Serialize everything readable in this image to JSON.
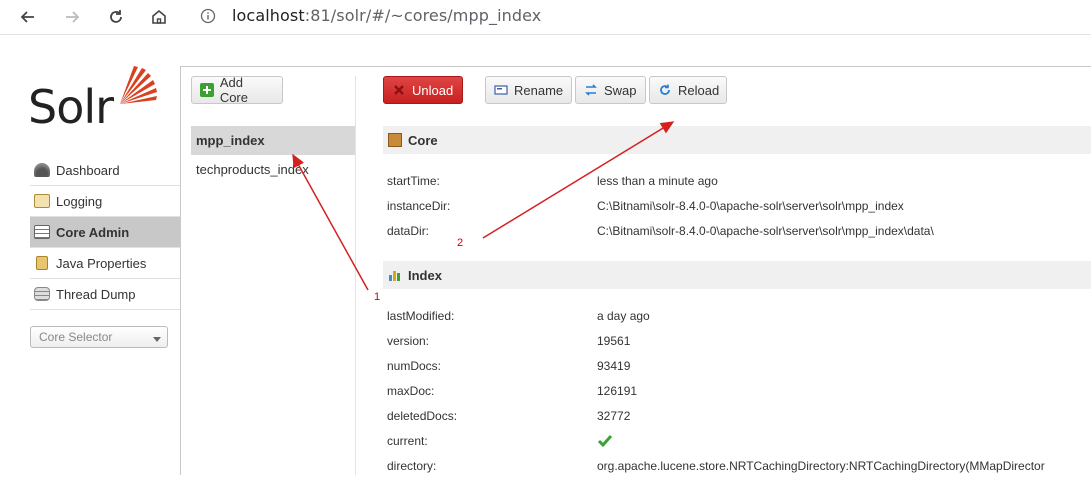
{
  "browser": {
    "url_host": "localhost",
    "url_path": ":81/solr/#/~cores/mpp_index"
  },
  "logo": {
    "text": "Solr"
  },
  "sidebar": {
    "items": [
      {
        "label": "Dashboard",
        "active": false,
        "icon": "dashboard-icon"
      },
      {
        "label": "Logging",
        "active": false,
        "icon": "logging-icon"
      },
      {
        "label": "Core Admin",
        "active": true,
        "icon": "core-admin-icon"
      },
      {
        "label": "Java Properties",
        "active": false,
        "icon": "java-properties-icon"
      },
      {
        "label": "Thread Dump",
        "active": false,
        "icon": "thread-dump-icon"
      }
    ],
    "core_selector": "Core Selector"
  },
  "toolbar": {
    "add_core": "Add Core",
    "unload": "Unload",
    "rename": "Rename",
    "swap": "Swap",
    "reload": "Reload"
  },
  "cores": [
    {
      "name": "mpp_index",
      "selected": true
    },
    {
      "name": "techproducts_index",
      "selected": false
    }
  ],
  "core_section": {
    "title": "Core",
    "rows": [
      {
        "key": "startTime:",
        "value": "less than a minute ago"
      },
      {
        "key": "instanceDir:",
        "value": "C:\\Bitnami\\solr-8.4.0-0\\apache-solr\\server\\solr\\mpp_index"
      },
      {
        "key": "dataDir:",
        "value": "C:\\Bitnami\\solr-8.4.0-0\\apache-solr\\server\\solr\\mpp_index\\data\\"
      }
    ]
  },
  "index_section": {
    "title": "Index",
    "rows": [
      {
        "key": "lastModified:",
        "value": "a day ago"
      },
      {
        "key": "version:",
        "value": "19561"
      },
      {
        "key": "numDocs:",
        "value": "93419"
      },
      {
        "key": "maxDoc:",
        "value": "126191"
      },
      {
        "key": "deletedDocs:",
        "value": "32772"
      },
      {
        "key": "current:",
        "value": ""
      },
      {
        "key": "directory:",
        "value": "org.apache.lucene.store.NRTCachingDirectory:NRTCachingDirectory(MMapDirector"
      }
    ]
  },
  "annotations": {
    "one": "1",
    "two": "2"
  },
  "colors": {
    "accent_red": "#d62020",
    "active_bg": "#c8c8c8",
    "check_green": "#3aa132"
  }
}
